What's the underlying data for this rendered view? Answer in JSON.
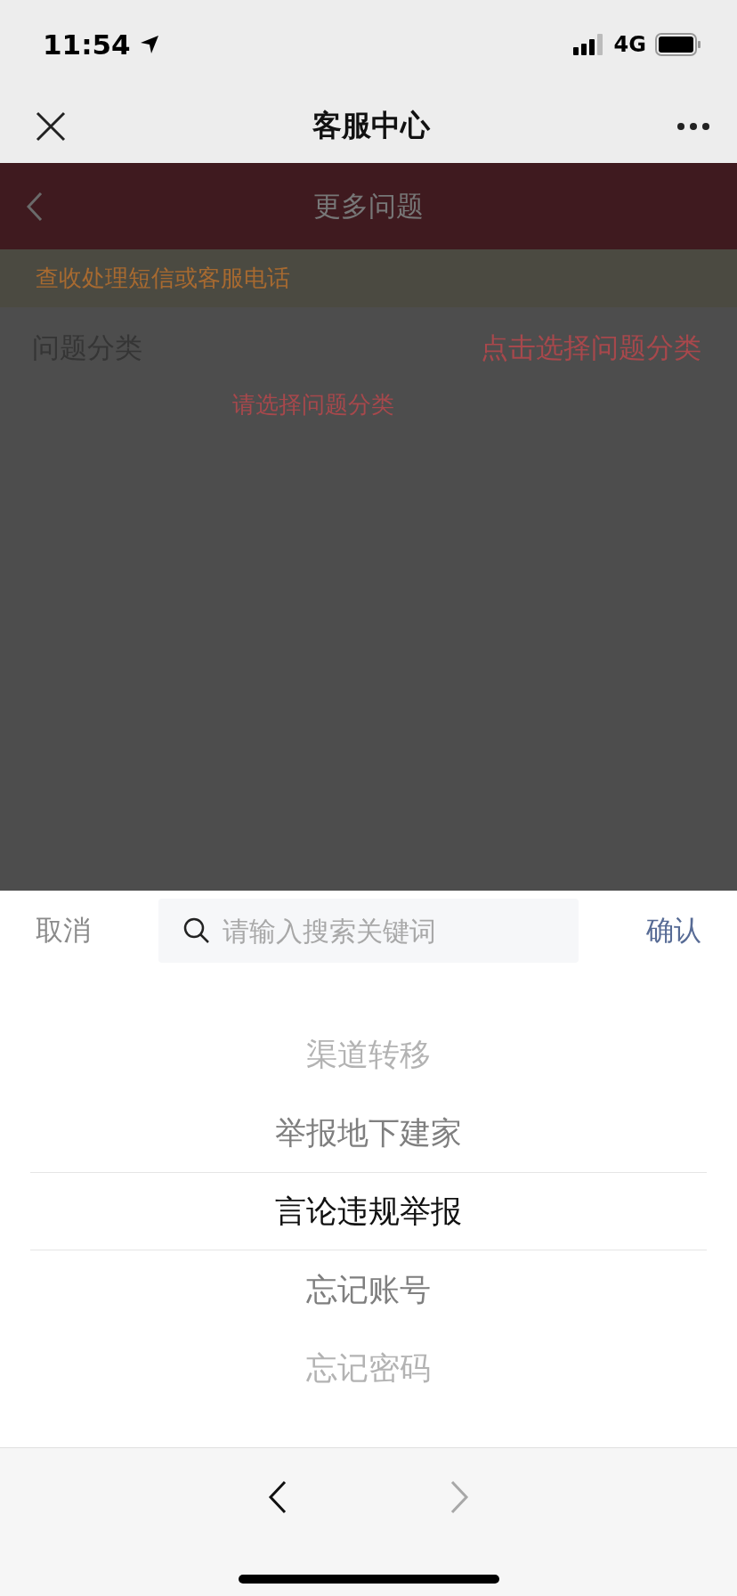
{
  "status_bar": {
    "time": "11:54",
    "network": "4G"
  },
  "nav_bar": {
    "title": "客服中心"
  },
  "page": {
    "header_title": "更多问题",
    "notice": "查收处理短信或客服电话",
    "form": {
      "label": "问题分类",
      "value": "点击选择问题分类",
      "error": "请选择问题分类"
    }
  },
  "picker": {
    "cancel": "取消",
    "confirm": "确认",
    "search": {
      "placeholder": "请输入搜索关键词"
    },
    "options": [
      {
        "label": "渠道转移",
        "selected": false
      },
      {
        "label": "举报地下建家",
        "selected": false
      },
      {
        "label": "言论违规举报",
        "selected": true
      },
      {
        "label": "忘记账号",
        "selected": false
      },
      {
        "label": "忘记密码",
        "selected": false
      }
    ]
  },
  "toolbar": {
    "back": {
      "disabled": false
    },
    "forward": {
      "disabled": true
    }
  }
}
